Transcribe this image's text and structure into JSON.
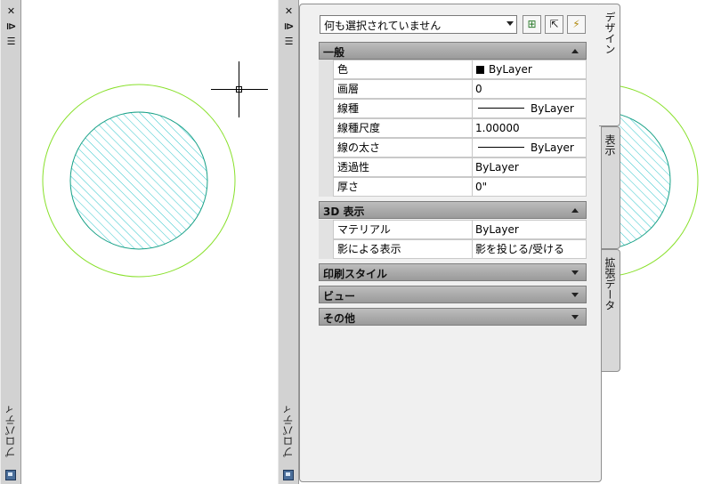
{
  "left_palette": {
    "close_icon": "close-icon",
    "label": "プロパティ"
  },
  "right_palette": {
    "label": "プロパティ"
  },
  "selection": {
    "value": "何も選択されていません"
  },
  "tabs": [
    {
      "label": "デザイン"
    },
    {
      "label": "表示"
    },
    {
      "label": "拡張データ"
    }
  ],
  "sections": {
    "general": {
      "title": "一般",
      "rows": [
        {
          "name": "色",
          "value": "ByLayer"
        },
        {
          "name": "画層",
          "value": "0"
        },
        {
          "name": "線種",
          "value": "ByLayer"
        },
        {
          "name": "線種尺度",
          "value": "1.00000"
        },
        {
          "name": "線の太さ",
          "value": "ByLayer"
        },
        {
          "name": "透過性",
          "value": "ByLayer"
        },
        {
          "name": "厚さ",
          "value": "0\""
        }
      ]
    },
    "view3d": {
      "title": "3D 表示",
      "rows": [
        {
          "name": "マテリアル",
          "value": "ByLayer"
        },
        {
          "name": "影による表示",
          "value": "影を投じる/受ける"
        }
      ]
    },
    "collapsed": [
      {
        "title": "印刷スタイル"
      },
      {
        "title": "ビュー"
      },
      {
        "title": "その他"
      }
    ]
  },
  "colors": {
    "outer_circle": "#88e02a",
    "inner_circle": "#16a086",
    "hatch": "#33c6cc"
  }
}
